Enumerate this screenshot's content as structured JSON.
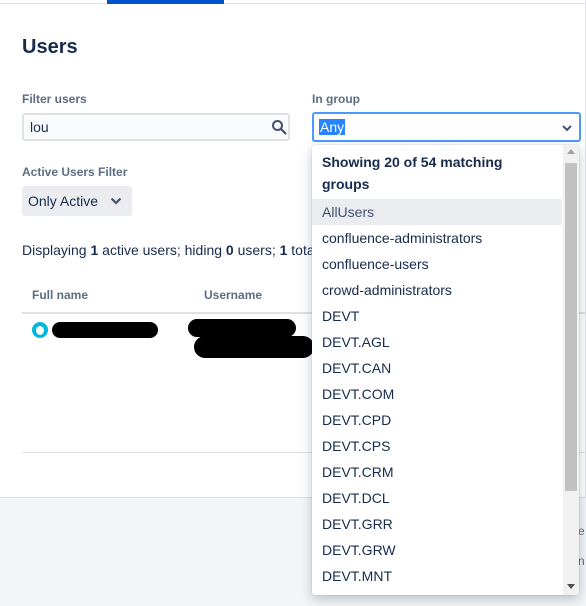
{
  "page": {
    "title": "Users"
  },
  "filter": {
    "label": "Filter users",
    "value": "lou",
    "search_icon": "search-icon"
  },
  "group": {
    "label": "In group",
    "selected": "Any",
    "chevron_icon": "chevron-down-icon"
  },
  "active_filter": {
    "label": "Active Users Filter",
    "value": "Only Active"
  },
  "status": {
    "prefix": "Displaying ",
    "active_count": "1",
    "mid1": " active users; hiding ",
    "hidden_count": "0",
    "mid2": " users; ",
    "total_count": "1",
    "suffix": " tota"
  },
  "table": {
    "headers": [
      "Full name",
      "Username"
    ]
  },
  "dropdown": {
    "header": "Showing 20 of 54 matching groups",
    "items": [
      "AllUsers",
      "confluence-administrators",
      "confluence-users",
      "crowd-administrators",
      "DEVT",
      "DEVT.AGL",
      "DEVT.CAN",
      "DEVT.COM",
      "DEVT.CPD",
      "DEVT.CPS",
      "DEVT.CRM",
      "DEVT.DCL",
      "DEVT.GRR",
      "DEVT.GRW",
      "DEVT.MNT"
    ]
  },
  "edge": {
    "e": "e",
    "n": "n"
  },
  "colors": {
    "accent": "#0052cc",
    "focus": "#4c9aff",
    "selection": "#2684ff",
    "text": "#172b4d",
    "muted": "#5e6c84"
  }
}
